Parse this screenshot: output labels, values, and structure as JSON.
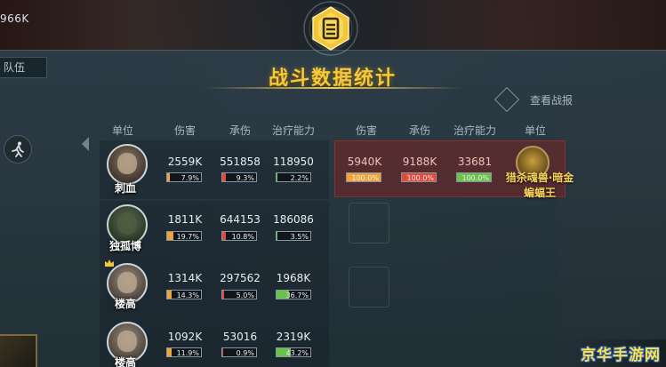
{
  "hud": {
    "power": "966K",
    "team_label": "队伍"
  },
  "header": {
    "title": "战斗数据统计",
    "report_button": "查看战报"
  },
  "left_team": {
    "columns": [
      "单位",
      "伤害",
      "承伤",
      "治疗能力"
    ],
    "rows": [
      {
        "name": "刺血",
        "damage": "2559K",
        "damage_pct": "7.9%",
        "damage_frac": 0.079,
        "taken": "551858",
        "taken_pct": "9.3%",
        "taken_frac": 0.093,
        "heal": "118950",
        "heal_pct": "2.2%",
        "heal_frac": 0.022
      },
      {
        "name": "独孤博",
        "damage": "1811K",
        "damage_pct": "19.7%",
        "damage_frac": 0.197,
        "taken": "644153",
        "taken_pct": "10.8%",
        "taken_frac": 0.108,
        "heal": "186086",
        "heal_pct": "3.5%",
        "heal_frac": 0.035
      },
      {
        "name": "楼高",
        "damage": "1314K",
        "damage_pct": "14.3%",
        "damage_frac": 0.143,
        "taken": "297562",
        "taken_pct": "5.0%",
        "taken_frac": 0.05,
        "heal": "1968K",
        "heal_pct": "36.7%",
        "heal_frac": 0.367
      },
      {
        "name": "楼高",
        "damage": "1092K",
        "damage_pct": "11.9%",
        "damage_frac": 0.119,
        "taken": "53016",
        "taken_pct": "0.9%",
        "taken_frac": 0.009,
        "heal": "2319K",
        "heal_pct": "43.2%",
        "heal_frac": 0.432
      }
    ]
  },
  "right_team": {
    "columns": [
      "伤害",
      "承伤",
      "治疗能力",
      "单位"
    ],
    "rows": [
      {
        "name_line1": "猎杀魂兽·暗金",
        "name_line2": "蝙蝠王",
        "damage": "5940K",
        "damage_pct": "100.0%",
        "damage_frac": 1.0,
        "taken": "9188K",
        "taken_pct": "100.0%",
        "taken_frac": 1.0,
        "heal": "33681",
        "heal_pct": "100.0%",
        "heal_frac": 1.0
      }
    ]
  },
  "colors": {
    "title": "#f6c93b",
    "damage_bar": "#f0a33a",
    "taken_bar": "#e24a3c",
    "heal_bar": "#69c24c",
    "enemy_bg": "#8c1e1c"
  },
  "watermark": "京华手游网"
}
